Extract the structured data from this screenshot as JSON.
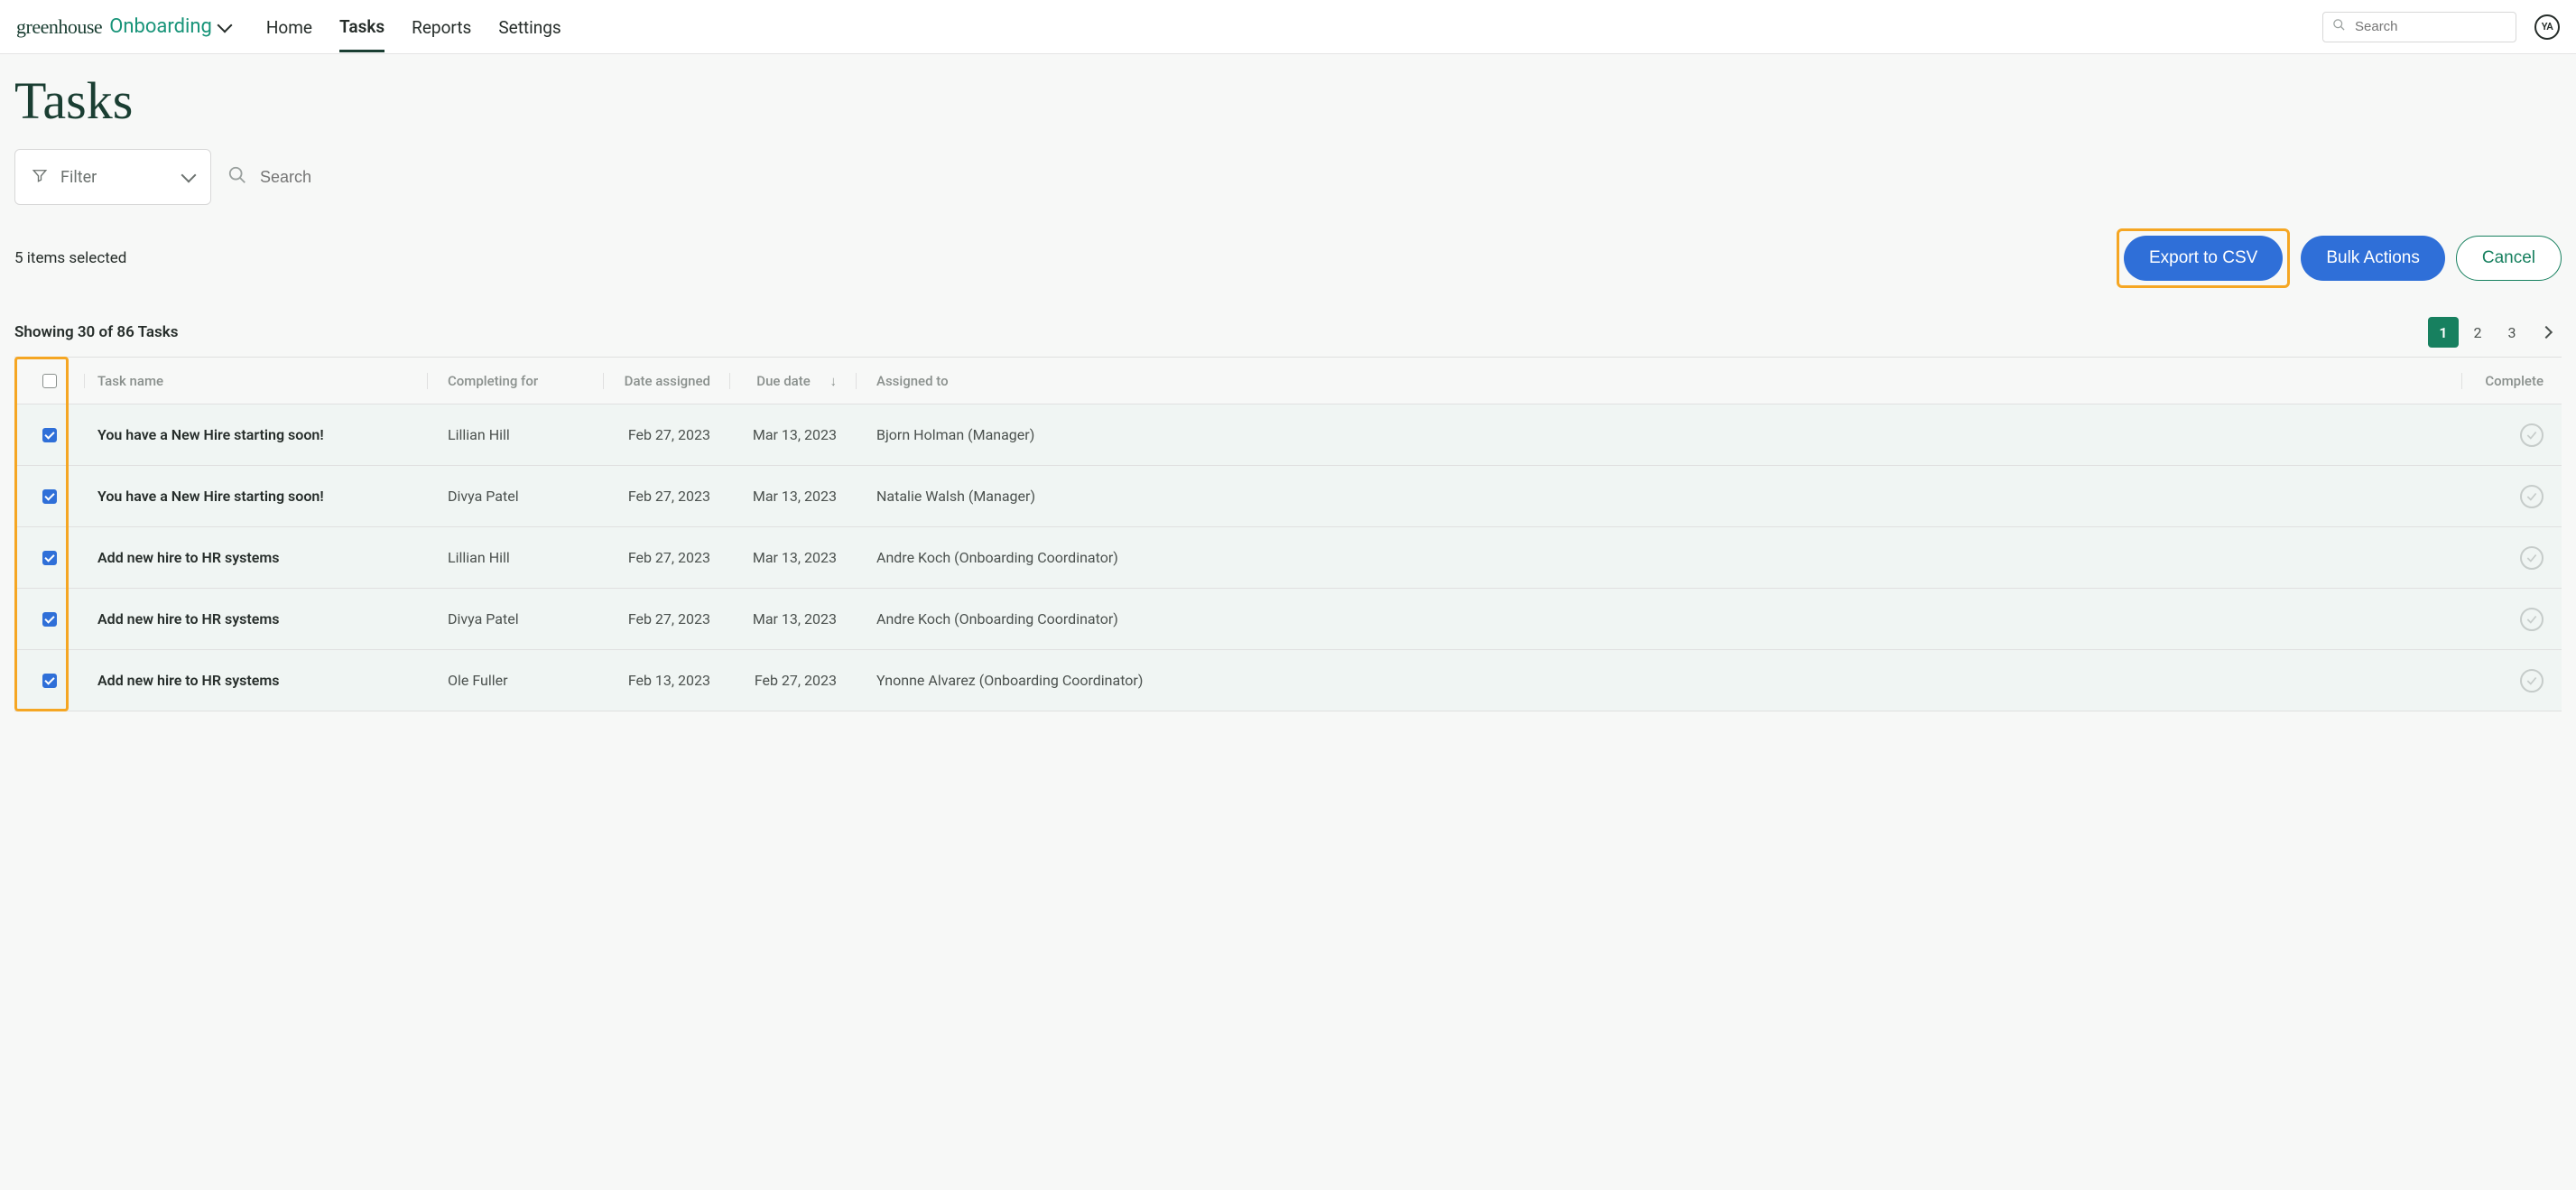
{
  "brand": {
    "greenhouse": "greenhouse",
    "onboarding": "Onboarding"
  },
  "nav": {
    "home": "Home",
    "tasks": "Tasks",
    "reports": "Reports",
    "settings": "Settings",
    "active": "tasks"
  },
  "globalSearch": {
    "placeholder": "Search"
  },
  "avatar": "YA",
  "page": {
    "title": "Tasks",
    "filterLabel": "Filter",
    "searchPlaceholder": "Search",
    "selectedCount": "5 items selected",
    "exportBtn": "Export to CSV",
    "bulkBtn": "Bulk Actions",
    "cancelBtn": "Cancel",
    "showing": "Showing 30 of 86 Tasks",
    "pages": [
      "1",
      "2",
      "3"
    ],
    "currentPage": "1"
  },
  "columns": {
    "taskName": "Task name",
    "completingFor": "Completing for",
    "dateAssigned": "Date assigned",
    "dueDate": "Due date",
    "assignedTo": "Assigned to",
    "complete": "Complete",
    "sortArrow": "↓"
  },
  "rows": [
    {
      "checked": true,
      "name": "You have a New Hire starting soon!",
      "for": "Lillian Hill",
      "assigned": "Feb 27, 2023",
      "due": "Mar 13, 2023",
      "to": "Bjorn Holman (Manager)"
    },
    {
      "checked": true,
      "name": "You have a New Hire starting soon!",
      "for": "Divya Patel",
      "assigned": "Feb 27, 2023",
      "due": "Mar 13, 2023",
      "to": "Natalie Walsh (Manager)"
    },
    {
      "checked": true,
      "name": "Add new hire to HR systems",
      "for": "Lillian Hill",
      "assigned": "Feb 27, 2023",
      "due": "Mar 13, 2023",
      "to": "Andre Koch (Onboarding Coordinator)"
    },
    {
      "checked": true,
      "name": "Add new hire to HR systems",
      "for": "Divya Patel",
      "assigned": "Feb 27, 2023",
      "due": "Mar 13, 2023",
      "to": "Andre Koch (Onboarding Coordinator)"
    },
    {
      "checked": true,
      "name": "Add new hire to HR systems",
      "for": "Ole Fuller",
      "assigned": "Feb 13, 2023",
      "due": "Feb 27, 2023",
      "to": "Ynonne Alvarez (Onboarding Coordinator)"
    }
  ]
}
